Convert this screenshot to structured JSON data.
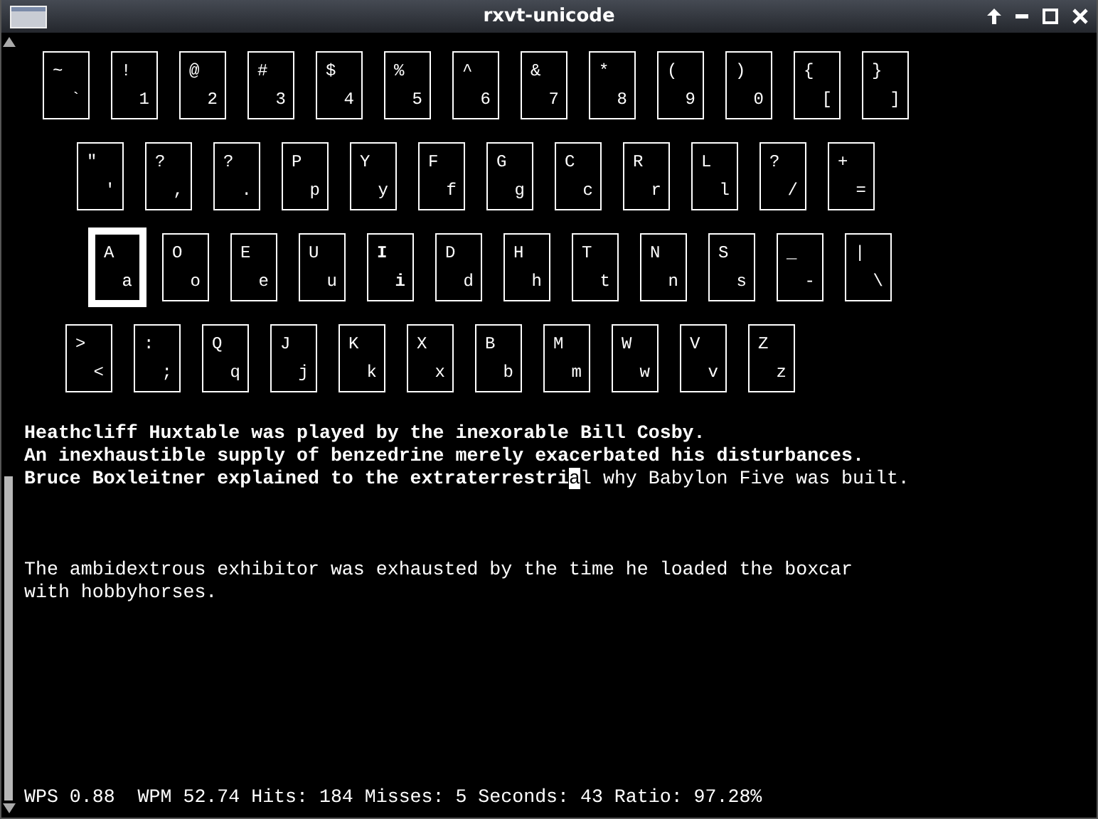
{
  "window": {
    "title": "rxvt-unicode"
  },
  "keyboard": {
    "rows": [
      [
        {
          "shift": "~",
          "base": "`",
          "selected": false,
          "last_pressed": false
        },
        {
          "shift": "!",
          "base": "1",
          "selected": false,
          "last_pressed": false
        },
        {
          "shift": "@",
          "base": "2",
          "selected": false,
          "last_pressed": false
        },
        {
          "shift": "#",
          "base": "3",
          "selected": false,
          "last_pressed": false
        },
        {
          "shift": "$",
          "base": "4",
          "selected": false,
          "last_pressed": false
        },
        {
          "shift": "%",
          "base": "5",
          "selected": false,
          "last_pressed": false
        },
        {
          "shift": "^",
          "base": "6",
          "selected": false,
          "last_pressed": false
        },
        {
          "shift": "&",
          "base": "7",
          "selected": false,
          "last_pressed": false
        },
        {
          "shift": "*",
          "base": "8",
          "selected": false,
          "last_pressed": false
        },
        {
          "shift": "(",
          "base": "9",
          "selected": false,
          "last_pressed": false
        },
        {
          "shift": ")",
          "base": "0",
          "selected": false,
          "last_pressed": false
        },
        {
          "shift": "{",
          "base": "[",
          "selected": false,
          "last_pressed": false
        },
        {
          "shift": "}",
          "base": "]",
          "selected": false,
          "last_pressed": false
        }
      ],
      [
        {
          "shift": "\"",
          "base": "'",
          "selected": false,
          "last_pressed": false
        },
        {
          "shift": "?",
          "base": ",",
          "selected": false,
          "last_pressed": false
        },
        {
          "shift": "?",
          "base": ".",
          "selected": false,
          "last_pressed": false
        },
        {
          "shift": "P",
          "base": "p",
          "selected": false,
          "last_pressed": false
        },
        {
          "shift": "Y",
          "base": "y",
          "selected": false,
          "last_pressed": false
        },
        {
          "shift": "F",
          "base": "f",
          "selected": false,
          "last_pressed": false
        },
        {
          "shift": "G",
          "base": "g",
          "selected": false,
          "last_pressed": false
        },
        {
          "shift": "C",
          "base": "c",
          "selected": false,
          "last_pressed": false
        },
        {
          "shift": "R",
          "base": "r",
          "selected": false,
          "last_pressed": false
        },
        {
          "shift": "L",
          "base": "l",
          "selected": false,
          "last_pressed": false
        },
        {
          "shift": "?",
          "base": "/",
          "selected": false,
          "last_pressed": false
        },
        {
          "shift": "+",
          "base": "=",
          "selected": false,
          "last_pressed": false
        }
      ],
      [
        {
          "shift": "A",
          "base": "a",
          "selected": true,
          "last_pressed": false
        },
        {
          "shift": "O",
          "base": "o",
          "selected": false,
          "last_pressed": false
        },
        {
          "shift": "E",
          "base": "e",
          "selected": false,
          "last_pressed": false
        },
        {
          "shift": "U",
          "base": "u",
          "selected": false,
          "last_pressed": false
        },
        {
          "shift": "I",
          "base": "i",
          "selected": false,
          "last_pressed": true
        },
        {
          "shift": "D",
          "base": "d",
          "selected": false,
          "last_pressed": false
        },
        {
          "shift": "H",
          "base": "h",
          "selected": false,
          "last_pressed": false
        },
        {
          "shift": "T",
          "base": "t",
          "selected": false,
          "last_pressed": false
        },
        {
          "shift": "N",
          "base": "n",
          "selected": false,
          "last_pressed": false
        },
        {
          "shift": "S",
          "base": "s",
          "selected": false,
          "last_pressed": false
        },
        {
          "shift": "_",
          "base": "-",
          "selected": false,
          "last_pressed": false
        },
        {
          "shift": "|",
          "base": "\\",
          "selected": false,
          "last_pressed": false
        }
      ],
      [
        {
          "shift": ">",
          "base": "<",
          "selected": false,
          "last_pressed": false
        },
        {
          "shift": ":",
          "base": ";",
          "selected": false,
          "last_pressed": false
        },
        {
          "shift": "Q",
          "base": "q",
          "selected": false,
          "last_pressed": false
        },
        {
          "shift": "J",
          "base": "j",
          "selected": false,
          "last_pressed": false
        },
        {
          "shift": "K",
          "base": "k",
          "selected": false,
          "last_pressed": false
        },
        {
          "shift": "X",
          "base": "x",
          "selected": false,
          "last_pressed": false
        },
        {
          "shift": "B",
          "base": "b",
          "selected": false,
          "last_pressed": false
        },
        {
          "shift": "M",
          "base": "m",
          "selected": false,
          "last_pressed": false
        },
        {
          "shift": "W",
          "base": "w",
          "selected": false,
          "last_pressed": false
        },
        {
          "shift": "V",
          "base": "v",
          "selected": false,
          "last_pressed": false
        },
        {
          "shift": "Z",
          "base": "z",
          "selected": false,
          "last_pressed": false
        }
      ]
    ]
  },
  "practice_lines": [
    [
      {
        "kind": "typed",
        "text": "Heathcliff Huxtable was played by the inexorable Bill Cosby."
      }
    ],
    [
      {
        "kind": "typed",
        "text": "An inexhaustible supply of benzedrine merely exacerbated his disturbances."
      }
    ],
    [
      {
        "kind": "typed",
        "text": "Bruce Boxleitner explained to the extraterrestri"
      },
      {
        "kind": "cursor",
        "text": "a"
      },
      {
        "kind": "pending",
        "text": "l why Babylon Five was built."
      }
    ]
  ],
  "next_lines": [
    "The ambidextrous exhibitor was exhausted by the time he loaded the boxcar",
    "with hobbyhorses."
  ],
  "status_bar": "WPS 0.88  WPM 52.74 Hits: 184 Misses: 5 Seconds: 43 Ratio: 97.28%"
}
